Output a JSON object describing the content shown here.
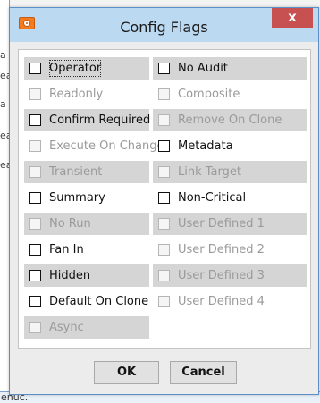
{
  "background": {
    "fragments": [
      "a",
      "ea",
      "a",
      "ea",
      "ea"
    ],
    "bottom_text": "enuc."
  },
  "dialog": {
    "title": "Config Flags",
    "close_label": "x"
  },
  "flags": {
    "left": [
      {
        "label": "Operator",
        "checked": false,
        "enabled": true
      },
      {
        "label": "Readonly",
        "checked": false,
        "enabled": false
      },
      {
        "label": "Confirm Required",
        "checked": false,
        "enabled": true
      },
      {
        "label": "Execute On Change",
        "checked": false,
        "enabled": false
      },
      {
        "label": "Transient",
        "checked": false,
        "enabled": false
      },
      {
        "label": "Summary",
        "checked": false,
        "enabled": true
      },
      {
        "label": "No Run",
        "checked": false,
        "enabled": false
      },
      {
        "label": "Fan In",
        "checked": false,
        "enabled": true
      },
      {
        "label": "Hidden",
        "checked": false,
        "enabled": true
      },
      {
        "label": "Default On Clone",
        "checked": false,
        "enabled": true
      },
      {
        "label": "Async",
        "checked": false,
        "enabled": false
      }
    ],
    "right": [
      {
        "label": "No Audit",
        "checked": false,
        "enabled": true
      },
      {
        "label": "Composite",
        "checked": false,
        "enabled": false
      },
      {
        "label": "Remove On Clone",
        "checked": false,
        "enabled": false
      },
      {
        "label": "Metadata",
        "checked": false,
        "enabled": true
      },
      {
        "label": "Link Target",
        "checked": false,
        "enabled": false
      },
      {
        "label": "Non-Critical",
        "checked": false,
        "enabled": true
      },
      {
        "label": "User Defined 1",
        "checked": false,
        "enabled": false
      },
      {
        "label": "User Defined 2",
        "checked": false,
        "enabled": false
      },
      {
        "label": "User Defined 3",
        "checked": false,
        "enabled": false
      },
      {
        "label": "User Defined 4",
        "checked": false,
        "enabled": false
      }
    ]
  },
  "buttons": {
    "ok": "OK",
    "cancel": "Cancel"
  }
}
